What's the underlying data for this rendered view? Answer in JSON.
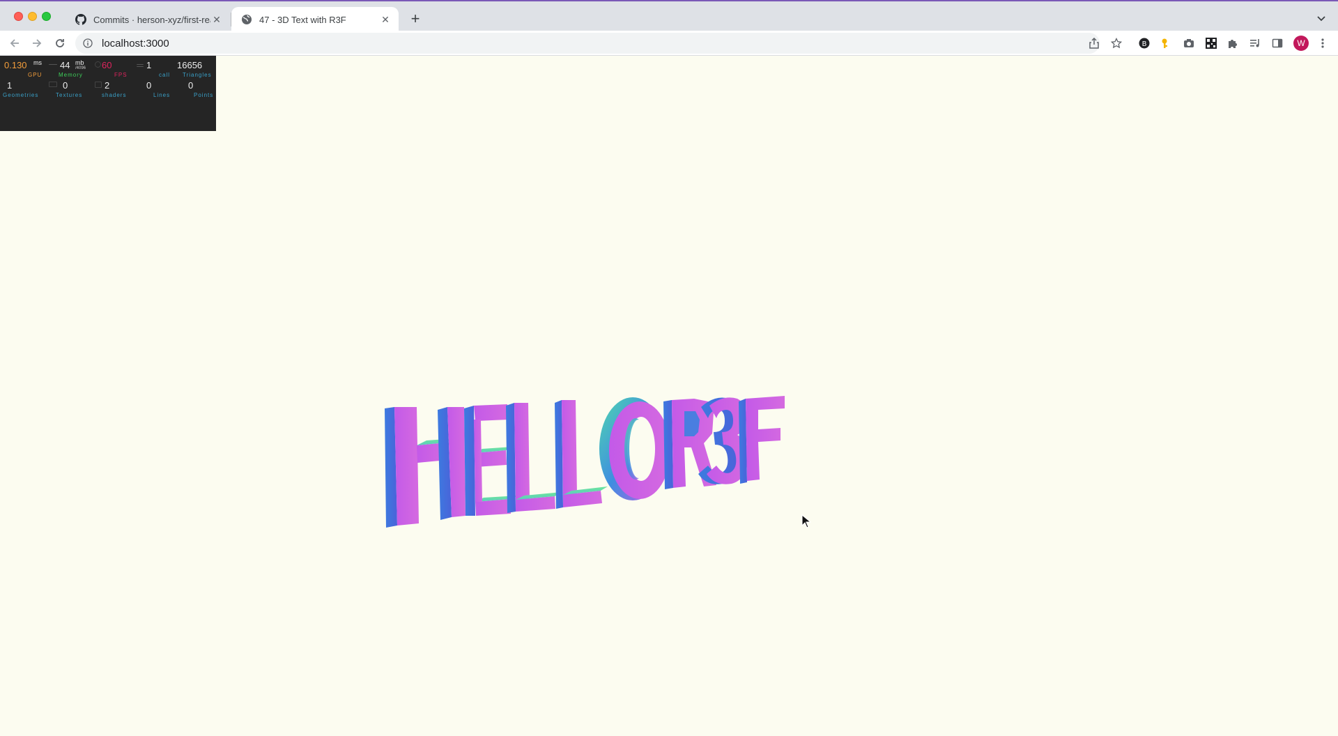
{
  "browser": {
    "tabs": [
      {
        "title": "Commits · herson-xyz/first-rea",
        "active": false,
        "favicon": "github-icon"
      },
      {
        "title": "47 - 3D Text with R3F",
        "active": true,
        "favicon": "globe-icon"
      }
    ],
    "url": "localhost:3000",
    "profile_initial": "W"
  },
  "perf": {
    "gpu": {
      "value": "0.130",
      "unit": "ms",
      "label": "GPU",
      "color": "#f49e3b"
    },
    "memory": {
      "value": "44",
      "unit": "mb",
      "sub": "/4096",
      "label": "Memory",
      "color": "#3dd05a"
    },
    "fps": {
      "value": "60",
      "label": "FPS",
      "color": "#e0245e"
    },
    "calls": {
      "value": "1",
      "label": "call",
      "color": "#3aa1c9"
    },
    "triangles": {
      "value": "16656",
      "label": "Triangles",
      "color": "#3aa1c9"
    },
    "geometries": {
      "value": "1",
      "label": "Geometries",
      "color": "#3aa1c9"
    },
    "textures": {
      "value": "0",
      "label": "Textures",
      "color": "#3aa1c9"
    },
    "shaders": {
      "value": "2",
      "label": "shaders",
      "color": "#3aa1c9"
    },
    "lines": {
      "value": "0",
      "label": "Lines",
      "color": "#3aa1c9"
    },
    "points": {
      "value": "0",
      "label": "Points",
      "color": "#3aa1c9"
    }
  },
  "scene": {
    "text3d": "HELLO R3F",
    "material": "normal",
    "background": "#fcfcf0"
  }
}
